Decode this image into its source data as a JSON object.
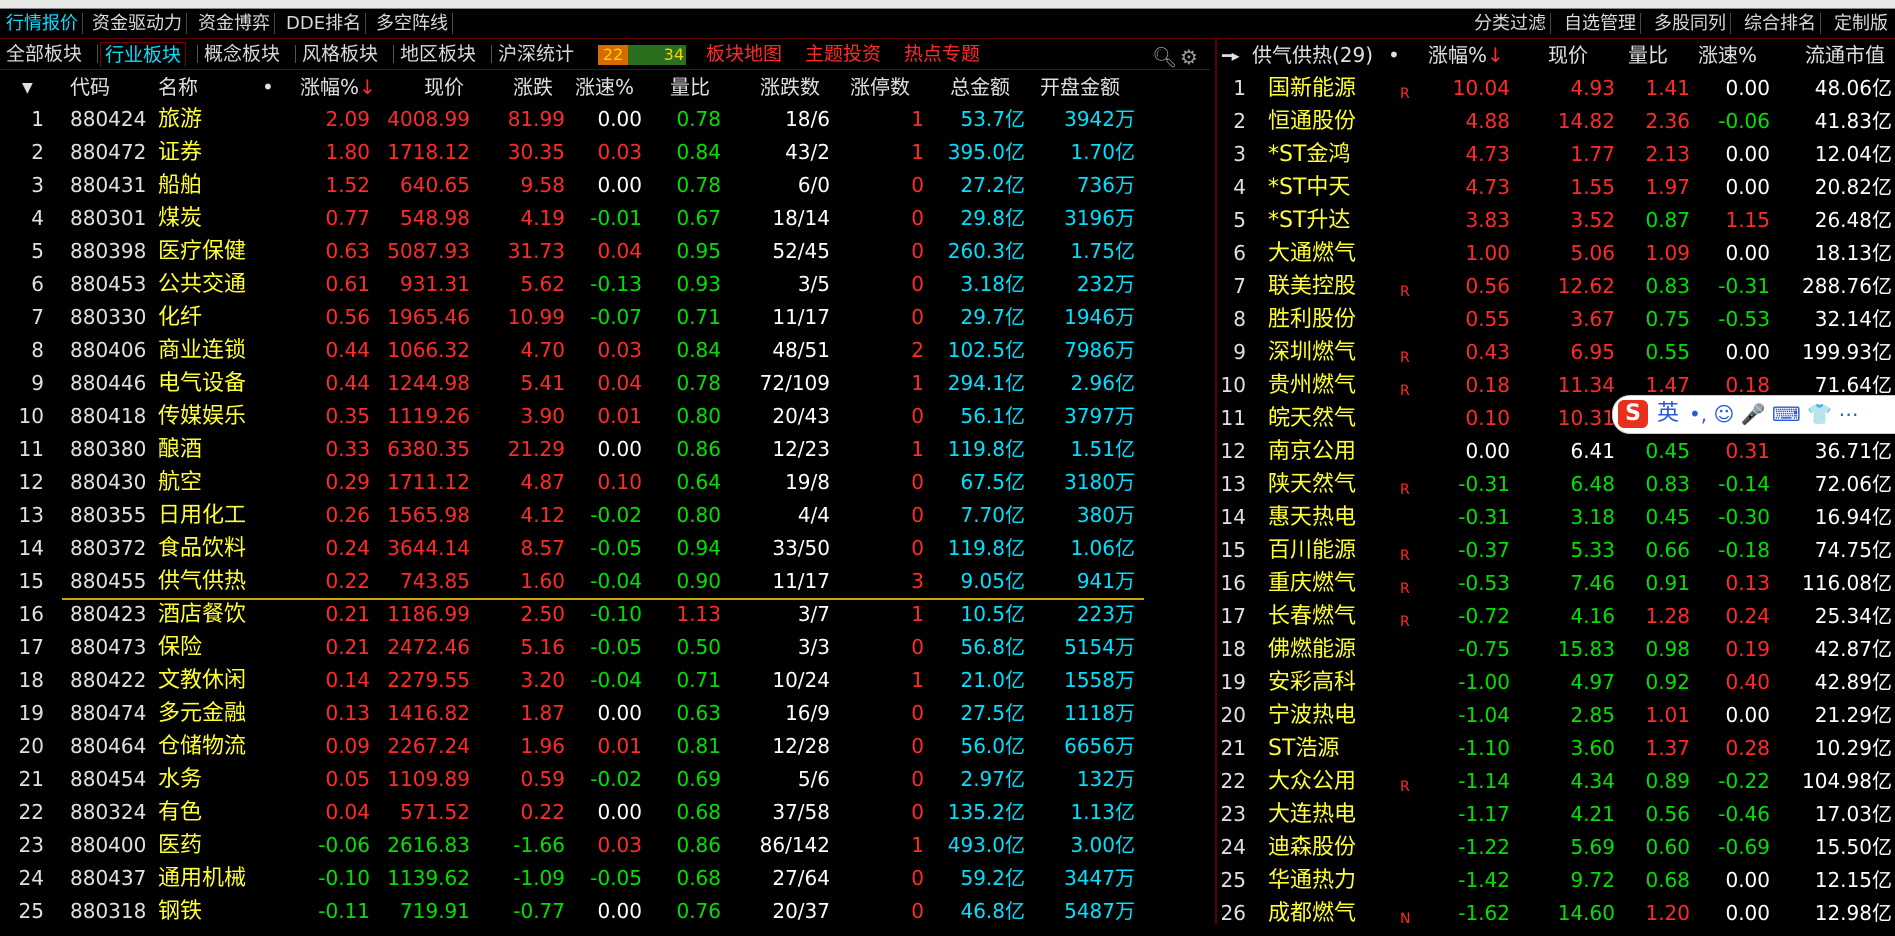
{
  "menu": {
    "left": [
      "行情报价",
      "资金驱动力",
      "资金博弈",
      "DDE排名",
      "多空阵线"
    ],
    "right": [
      "分类过滤",
      "自选管理",
      "多股同列",
      "综合排名",
      "定制版"
    ]
  },
  "tabs": {
    "items": [
      "全部板块",
      "行业板块",
      "概念板块",
      "风格板块",
      "地区板块",
      "沪深统计"
    ],
    "up_count": "22",
    "down_count": "34",
    "links": [
      "板块地图",
      "主题投资",
      "热点专题"
    ]
  },
  "left_table": {
    "headers": [
      "代码",
      "名称",
      "•",
      "涨幅%",
      "现价",
      "涨跌",
      "涨速%",
      "量比",
      "涨跌数",
      "涨停数",
      "总金额",
      "开盘金额"
    ],
    "sort_marker": "↓",
    "rows": [
      {
        "i": "1",
        "code": "880424",
        "name": "旅游",
        "pct": "2.09",
        "price": "4008.99",
        "chg": "81.99",
        "spd": "0.00",
        "vr": "0.78",
        "ud": "18/6",
        "lim": "1",
        "amt": "53.7亿",
        "open": "3942万"
      },
      {
        "i": "2",
        "code": "880472",
        "name": "证券",
        "pct": "1.80",
        "price": "1718.12",
        "chg": "30.35",
        "spd": "0.03",
        "vr": "0.84",
        "ud": "43/2",
        "lim": "1",
        "amt": "395.0亿",
        "open": "1.70亿"
      },
      {
        "i": "3",
        "code": "880431",
        "name": "船舶",
        "pct": "1.52",
        "price": "640.65",
        "chg": "9.58",
        "spd": "0.00",
        "vr": "0.78",
        "ud": "6/0",
        "lim": "0",
        "amt": "27.2亿",
        "open": "736万"
      },
      {
        "i": "4",
        "code": "880301",
        "name": "煤炭",
        "pct": "0.77",
        "price": "548.98",
        "chg": "4.19",
        "spd": "-0.01",
        "vr": "0.67",
        "ud": "18/14",
        "lim": "0",
        "amt": "29.8亿",
        "open": "3196万"
      },
      {
        "i": "5",
        "code": "880398",
        "name": "医疗保健",
        "pct": "0.63",
        "price": "5087.93",
        "chg": "31.73",
        "spd": "0.04",
        "vr": "0.95",
        "ud": "52/45",
        "lim": "0",
        "amt": "260.3亿",
        "open": "1.75亿"
      },
      {
        "i": "6",
        "code": "880453",
        "name": "公共交通",
        "pct": "0.61",
        "price": "931.31",
        "chg": "5.62",
        "spd": "-0.13",
        "vr": "0.93",
        "ud": "3/5",
        "lim": "0",
        "amt": "3.18亿",
        "open": "232万"
      },
      {
        "i": "7",
        "code": "880330",
        "name": "化纤",
        "pct": "0.56",
        "price": "1965.46",
        "chg": "10.99",
        "spd": "-0.07",
        "vr": "0.71",
        "ud": "11/17",
        "lim": "0",
        "amt": "29.7亿",
        "open": "1946万"
      },
      {
        "i": "8",
        "code": "880406",
        "name": "商业连锁",
        "pct": "0.44",
        "price": "1066.32",
        "chg": "4.70",
        "spd": "0.03",
        "vr": "0.84",
        "ud": "48/51",
        "lim": "2",
        "amt": "102.5亿",
        "open": "7986万"
      },
      {
        "i": "9",
        "code": "880446",
        "name": "电气设备",
        "pct": "0.44",
        "price": "1244.98",
        "chg": "5.41",
        "spd": "0.04",
        "vr": "0.78",
        "ud": "72/109",
        "lim": "1",
        "amt": "294.1亿",
        "open": "2.96亿"
      },
      {
        "i": "10",
        "code": "880418",
        "name": "传媒娱乐",
        "pct": "0.35",
        "price": "1119.26",
        "chg": "3.90",
        "spd": "0.01",
        "vr": "0.80",
        "ud": "20/43",
        "lim": "0",
        "amt": "56.1亿",
        "open": "3797万"
      },
      {
        "i": "11",
        "code": "880380",
        "name": "酿酒",
        "pct": "0.33",
        "price": "6380.35",
        "chg": "21.29",
        "spd": "0.00",
        "vr": "0.86",
        "ud": "12/23",
        "lim": "1",
        "amt": "119.8亿",
        "open": "1.51亿"
      },
      {
        "i": "12",
        "code": "880430",
        "name": "航空",
        "pct": "0.29",
        "price": "1711.12",
        "chg": "4.87",
        "spd": "0.10",
        "vr": "0.64",
        "ud": "19/8",
        "lim": "0",
        "amt": "67.5亿",
        "open": "3180万"
      },
      {
        "i": "13",
        "code": "880355",
        "name": "日用化工",
        "pct": "0.26",
        "price": "1565.98",
        "chg": "4.12",
        "spd": "-0.02",
        "vr": "0.80",
        "ud": "4/4",
        "lim": "0",
        "amt": "7.70亿",
        "open": "380万"
      },
      {
        "i": "14",
        "code": "880372",
        "name": "食品饮料",
        "pct": "0.24",
        "price": "3644.14",
        "chg": "8.57",
        "spd": "-0.05",
        "vr": "0.94",
        "ud": "33/50",
        "lim": "0",
        "amt": "119.8亿",
        "open": "1.06亿"
      },
      {
        "i": "15",
        "code": "880455",
        "name": "供气供热",
        "pct": "0.22",
        "price": "743.85",
        "chg": "1.60",
        "spd": "-0.04",
        "vr": "0.90",
        "ud": "11/17",
        "lim": "3",
        "amt": "9.05亿",
        "open": "941万"
      },
      {
        "i": "16",
        "code": "880423",
        "name": "酒店餐饮",
        "pct": "0.21",
        "price": "1186.99",
        "chg": "2.50",
        "spd": "-0.10",
        "vr": "1.13",
        "ud": "3/7",
        "lim": "1",
        "amt": "10.5亿",
        "open": "223万"
      },
      {
        "i": "17",
        "code": "880473",
        "name": "保险",
        "pct": "0.21",
        "price": "2472.46",
        "chg": "5.16",
        "spd": "-0.05",
        "vr": "0.50",
        "ud": "3/3",
        "lim": "0",
        "amt": "56.8亿",
        "open": "5154万"
      },
      {
        "i": "18",
        "code": "880422",
        "name": "文教休闲",
        "pct": "0.14",
        "price": "2279.55",
        "chg": "3.20",
        "spd": "-0.04",
        "vr": "0.71",
        "ud": "10/24",
        "lim": "1",
        "amt": "21.0亿",
        "open": "1558万"
      },
      {
        "i": "19",
        "code": "880474",
        "name": "多元金融",
        "pct": "0.13",
        "price": "1416.82",
        "chg": "1.87",
        "spd": "0.00",
        "vr": "0.63",
        "ud": "16/9",
        "lim": "0",
        "amt": "27.5亿",
        "open": "1118万"
      },
      {
        "i": "20",
        "code": "880464",
        "name": "仓储物流",
        "pct": "0.09",
        "price": "2267.24",
        "chg": "1.96",
        "spd": "0.01",
        "vr": "0.81",
        "ud": "12/28",
        "lim": "0",
        "amt": "56.0亿",
        "open": "6656万"
      },
      {
        "i": "21",
        "code": "880454",
        "name": "水务",
        "pct": "0.05",
        "price": "1109.89",
        "chg": "0.59",
        "spd": "-0.02",
        "vr": "0.69",
        "ud": "5/6",
        "lim": "0",
        "amt": "2.97亿",
        "open": "132万"
      },
      {
        "i": "22",
        "code": "880324",
        "name": "有色",
        "pct": "0.04",
        "price": "571.52",
        "chg": "0.22",
        "spd": "0.00",
        "vr": "0.68",
        "ud": "37/58",
        "lim": "0",
        "amt": "135.2亿",
        "open": "1.13亿"
      },
      {
        "i": "23",
        "code": "880400",
        "name": "医药",
        "pct": "-0.06",
        "price": "2616.83",
        "chg": "-1.66",
        "spd": "0.03",
        "vr": "0.86",
        "ud": "86/142",
        "lim": "1",
        "amt": "493.0亿",
        "open": "3.00亿"
      },
      {
        "i": "24",
        "code": "880437",
        "name": "通用机械",
        "pct": "-0.10",
        "price": "1139.62",
        "chg": "-1.09",
        "spd": "-0.05",
        "vr": "0.68",
        "ud": "27/64",
        "lim": "0",
        "amt": "59.2亿",
        "open": "3447万"
      },
      {
        "i": "25",
        "code": "880318",
        "name": "钢铁",
        "pct": "-0.11",
        "price": "719.91",
        "chg": "-0.77",
        "spd": "0.00",
        "vr": "0.76",
        "ud": "20/37",
        "lim": "0",
        "amt": "46.8亿",
        "open": "5487万"
      }
    ]
  },
  "right_panel": {
    "title": "供气供热(29)",
    "headers": [
      "涨幅%",
      "现价",
      "量比",
      "涨速%",
      "流通市值"
    ],
    "sort_marker": "↓",
    "rows": [
      {
        "i": "1",
        "name": "国新能源",
        "b": "R",
        "pct": "10.04",
        "price": "4.93",
        "vr": "1.41",
        "spd": "0.00",
        "cap": "48.06亿"
      },
      {
        "i": "2",
        "name": "恒通股份",
        "b": "",
        "pct": "4.88",
        "price": "14.82",
        "vr": "2.36",
        "spd": "-0.06",
        "cap": "41.83亿"
      },
      {
        "i": "3",
        "name": "*ST金鸿",
        "b": "",
        "pct": "4.73",
        "price": "1.77",
        "vr": "2.13",
        "spd": "0.00",
        "cap": "12.04亿"
      },
      {
        "i": "4",
        "name": "*ST中天",
        "b": "",
        "pct": "4.73",
        "price": "1.55",
        "vr": "1.97",
        "spd": "0.00",
        "cap": "20.82亿"
      },
      {
        "i": "5",
        "name": "*ST升达",
        "b": "",
        "pct": "3.83",
        "price": "3.52",
        "vr": "0.87",
        "spd": "1.15",
        "cap": "26.48亿"
      },
      {
        "i": "6",
        "name": "大通燃气",
        "b": "",
        "pct": "1.00",
        "price": "5.06",
        "vr": "1.09",
        "spd": "0.00",
        "cap": "18.13亿"
      },
      {
        "i": "7",
        "name": "联美控股",
        "b": "R",
        "pct": "0.56",
        "price": "12.62",
        "vr": "0.83",
        "spd": "-0.31",
        "cap": "288.76亿"
      },
      {
        "i": "8",
        "name": "胜利股份",
        "b": "",
        "pct": "0.55",
        "price": "3.67",
        "vr": "0.75",
        "spd": "-0.53",
        "cap": "32.14亿"
      },
      {
        "i": "9",
        "name": "深圳燃气",
        "b": "R",
        "pct": "0.43",
        "price": "6.95",
        "vr": "0.55",
        "spd": "0.00",
        "cap": "199.93亿"
      },
      {
        "i": "10",
        "name": "贵州燃气",
        "b": "R",
        "pct": "0.18",
        "price": "11.34",
        "vr": "1.47",
        "spd": "0.18",
        "cap": "71.64亿"
      },
      {
        "i": "11",
        "name": "皖天然气",
        "b": "",
        "pct": "0.10",
        "price": "10.31",
        "vr": "",
        "spd": "",
        "cap": ""
      },
      {
        "i": "12",
        "name": "南京公用",
        "b": "",
        "pct": "0.00",
        "price": "6.41",
        "vr": "0.45",
        "spd": "0.31",
        "cap": "36.71亿"
      },
      {
        "i": "13",
        "name": "陕天然气",
        "b": "R",
        "pct": "-0.31",
        "price": "6.48",
        "vr": "0.83",
        "spd": "-0.14",
        "cap": "72.06亿"
      },
      {
        "i": "14",
        "name": "惠天热电",
        "b": "",
        "pct": "-0.31",
        "price": "3.18",
        "vr": "0.45",
        "spd": "-0.30",
        "cap": "16.94亿"
      },
      {
        "i": "15",
        "name": "百川能源",
        "b": "R",
        "pct": "-0.37",
        "price": "5.33",
        "vr": "0.66",
        "spd": "-0.18",
        "cap": "74.75亿"
      },
      {
        "i": "16",
        "name": "重庆燃气",
        "b": "R",
        "pct": "-0.53",
        "price": "7.46",
        "vr": "0.91",
        "spd": "0.13",
        "cap": "116.08亿"
      },
      {
        "i": "17",
        "name": "长春燃气",
        "b": "R",
        "pct": "-0.72",
        "price": "4.16",
        "vr": "1.28",
        "spd": "0.24",
        "cap": "25.34亿"
      },
      {
        "i": "18",
        "name": "佛燃能源",
        "b": "",
        "pct": "-0.75",
        "price": "15.83",
        "vr": "0.98",
        "spd": "0.19",
        "cap": "42.87亿"
      },
      {
        "i": "19",
        "name": "安彩高科",
        "b": "",
        "pct": "-1.00",
        "price": "4.97",
        "vr": "0.92",
        "spd": "0.40",
        "cap": "42.89亿"
      },
      {
        "i": "20",
        "name": "宁波热电",
        "b": "",
        "pct": "-1.04",
        "price": "2.85",
        "vr": "1.01",
        "spd": "0.00",
        "cap": "21.29亿"
      },
      {
        "i": "21",
        "name": "ST浩源",
        "b": "",
        "pct": "-1.10",
        "price": "3.60",
        "vr": "1.37",
        "spd": "0.28",
        "cap": "10.29亿"
      },
      {
        "i": "22",
        "name": "大众公用",
        "b": "R",
        "pct": "-1.14",
        "price": "4.34",
        "vr": "0.89",
        "spd": "-0.22",
        "cap": "104.98亿"
      },
      {
        "i": "23",
        "name": "大连热电",
        "b": "",
        "pct": "-1.17",
        "price": "4.21",
        "vr": "0.56",
        "spd": "-0.46",
        "cap": "17.03亿"
      },
      {
        "i": "24",
        "name": "迪森股份",
        "b": "",
        "pct": "-1.22",
        "price": "5.69",
        "vr": "0.60",
        "spd": "-0.69",
        "cap": "15.50亿"
      },
      {
        "i": "25",
        "name": "华通热力",
        "b": "",
        "pct": "-1.42",
        "price": "9.72",
        "vr": "0.68",
        "spd": "0.00",
        "cap": "12.15亿"
      },
      {
        "i": "26",
        "name": "成都燃气",
        "b": "N",
        "pct": "-1.62",
        "price": "14.60",
        "vr": "1.20",
        "spd": "0.00",
        "cap": "12.98亿"
      }
    ]
  },
  "ime": {
    "logo": "S",
    "mode": "英",
    "symbols": "•, ☺ 🎤 ⌨ 👕 ⋯"
  },
  "colors": {
    "up": "#ff2a2a",
    "down": "#00e100",
    "flat": "#ffffff",
    "name": "#ffff33",
    "amount": "#00e0ff",
    "active_tab": "#00e0ff"
  }
}
